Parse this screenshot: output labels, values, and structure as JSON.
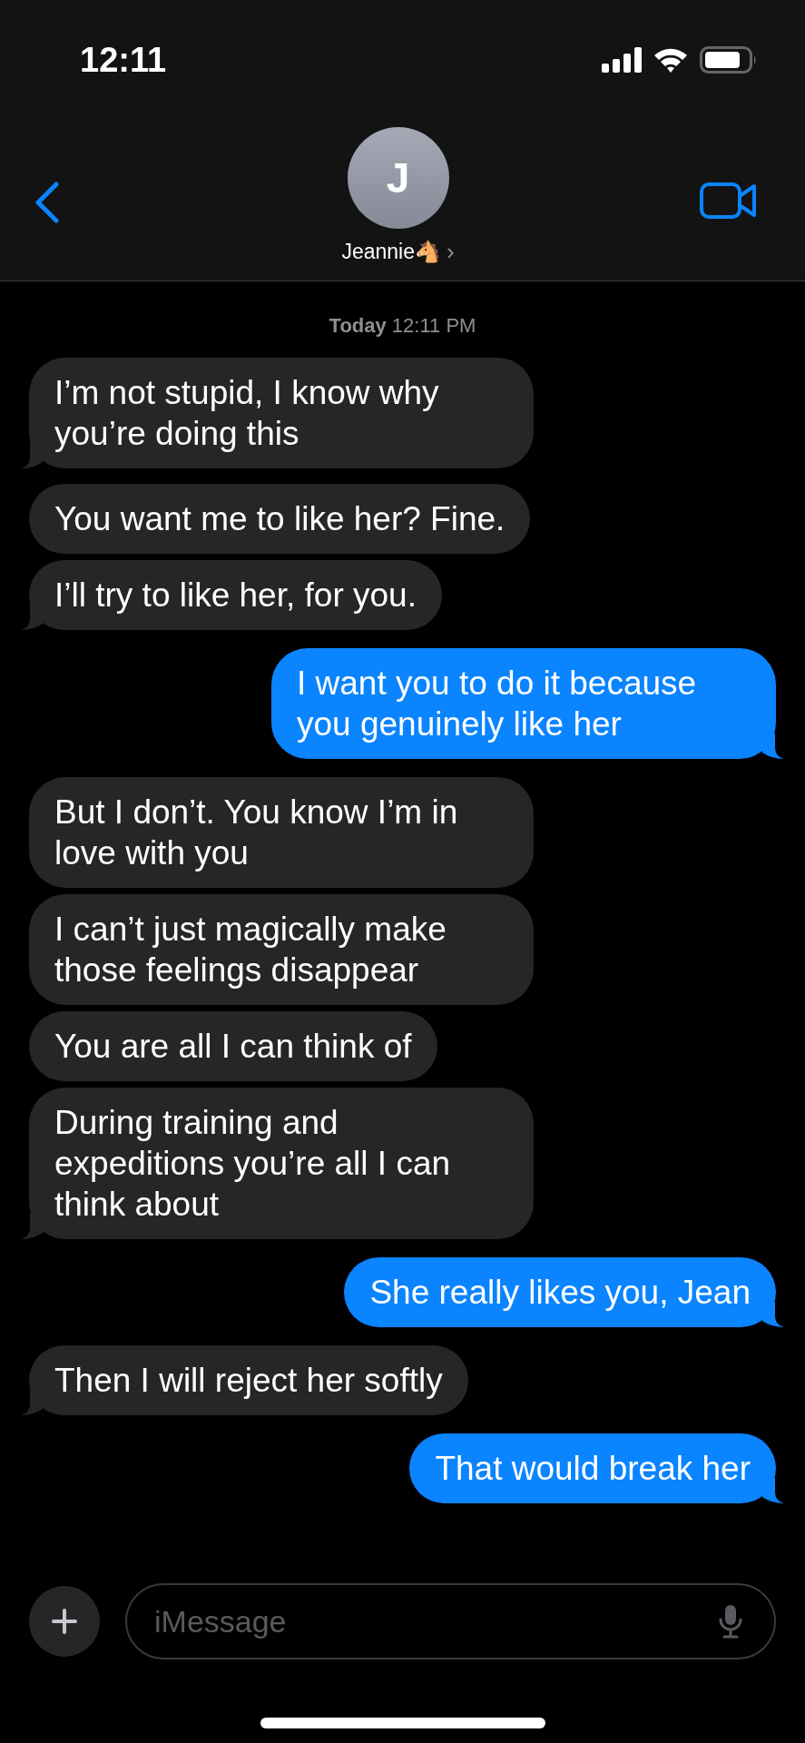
{
  "status_bar": {
    "time": "12:11"
  },
  "header": {
    "avatar_initial": "J",
    "contact_name": "Jeannie🐴",
    "chevron": "›"
  },
  "timestamp": {
    "day": "Today",
    "time": "12:11 PM"
  },
  "messages": [
    {
      "kind": "received",
      "text": "I’m not stupid, I know why you’re doing this",
      "tail": true
    },
    {
      "kind": "received",
      "text": "You want me to like her? Fine.",
      "tail": false
    },
    {
      "kind": "received",
      "text": "I’ll try to like her, for you.",
      "tail": true
    },
    {
      "kind": "sent",
      "text": "I want you to do it because you genuinely like her",
      "tail": true
    },
    {
      "kind": "received",
      "text": "But I don’t. You know I’m in love with you",
      "tail": false
    },
    {
      "kind": "received",
      "text": "I can’t just magically make those feelings disappear",
      "tail": false
    },
    {
      "kind": "received",
      "text": "You are all I can think of",
      "tail": false
    },
    {
      "kind": "received",
      "text": "During training and expeditions you’re all I can think about",
      "tail": true
    },
    {
      "kind": "sent",
      "text": "She really likes you, Jean",
      "tail": true
    },
    {
      "kind": "received",
      "text": "Then I will reject her softly",
      "tail": true
    },
    {
      "kind": "sent",
      "text": "That would break her",
      "tail": true
    }
  ],
  "composer": {
    "placeholder": "iMessage"
  }
}
